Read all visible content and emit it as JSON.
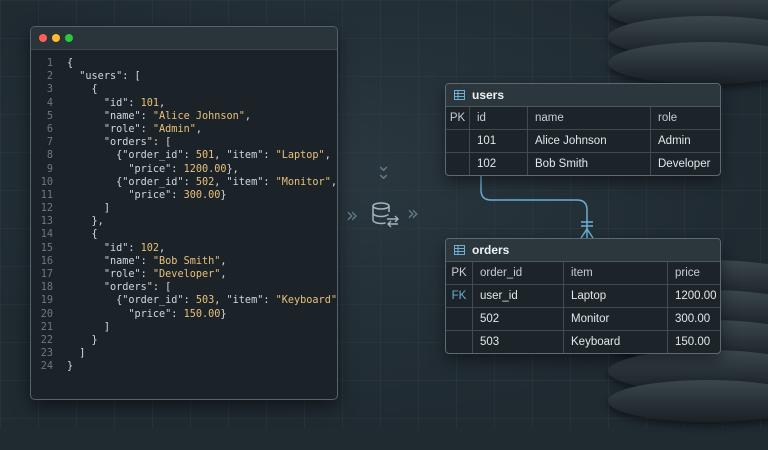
{
  "window": {
    "controls": [
      {
        "name": "close",
        "color": "#ff5f57"
      },
      {
        "name": "minimize",
        "color": "#febc2e"
      },
      {
        "name": "maximize",
        "color": "#28c840"
      }
    ]
  },
  "code": {
    "lines": [
      {
        "n": "1",
        "indent": 0,
        "tokens": [
          [
            "p",
            "{"
          ]
        ]
      },
      {
        "n": "2",
        "indent": 1,
        "tokens": [
          [
            "k",
            "\"users\""
          ],
          [
            "p",
            ": ["
          ]
        ]
      },
      {
        "n": "3",
        "indent": 2,
        "tokens": [
          [
            "p",
            "{"
          ]
        ]
      },
      {
        "n": "4",
        "indent": 3,
        "tokens": [
          [
            "k",
            "\"id\""
          ],
          [
            "p",
            ": "
          ],
          [
            "n",
            "101"
          ],
          [
            "p",
            ","
          ]
        ]
      },
      {
        "n": "5",
        "indent": 3,
        "tokens": [
          [
            "k",
            "\"name\""
          ],
          [
            "p",
            ": "
          ],
          [
            "s",
            "\"Alice Johnson\""
          ],
          [
            "p",
            ","
          ]
        ]
      },
      {
        "n": "6",
        "indent": 3,
        "tokens": [
          [
            "k",
            "\"role\""
          ],
          [
            "p",
            ": "
          ],
          [
            "s",
            "\"Admin\""
          ],
          [
            "p",
            ","
          ]
        ]
      },
      {
        "n": "7",
        "indent": 3,
        "tokens": [
          [
            "k",
            "\"orders\""
          ],
          [
            "p",
            ": ["
          ]
        ]
      },
      {
        "n": "8",
        "indent": 4,
        "tokens": [
          [
            "p",
            "{"
          ],
          [
            "k",
            "\"order_id\""
          ],
          [
            "p",
            ": "
          ],
          [
            "n",
            "501"
          ],
          [
            "p",
            ", "
          ],
          [
            "k",
            "\"item\""
          ],
          [
            "p",
            ": "
          ],
          [
            "s",
            "\"Laptop\""
          ],
          [
            "p",
            ","
          ]
        ]
      },
      {
        "n": "9",
        "indent": 5,
        "tokens": [
          [
            "k",
            "\"price\""
          ],
          [
            "p",
            ": "
          ],
          [
            "n",
            "1200.00"
          ],
          [
            "p",
            "},"
          ]
        ]
      },
      {
        "n": "10",
        "indent": 4,
        "tokens": [
          [
            "p",
            "{"
          ],
          [
            "k",
            "\"order_id\""
          ],
          [
            "p",
            ": "
          ],
          [
            "n",
            "502"
          ],
          [
            "p",
            ", "
          ],
          [
            "k",
            "\"item\""
          ],
          [
            "p",
            ": "
          ],
          [
            "s",
            "\"Monitor\""
          ],
          [
            "p",
            ","
          ]
        ]
      },
      {
        "n": "11",
        "indent": 5,
        "tokens": [
          [
            "k",
            "\"price\""
          ],
          [
            "p",
            ": "
          ],
          [
            "n",
            "300.00"
          ],
          [
            "p",
            "}"
          ]
        ]
      },
      {
        "n": "12",
        "indent": 3,
        "tokens": [
          [
            "p",
            "]"
          ]
        ]
      },
      {
        "n": "13",
        "indent": 2,
        "tokens": [
          [
            "p",
            "},"
          ]
        ]
      },
      {
        "n": "14",
        "indent": 2,
        "tokens": [
          [
            "p",
            "{"
          ]
        ]
      },
      {
        "n": "15",
        "indent": 3,
        "tokens": [
          [
            "k",
            "\"id\""
          ],
          [
            "p",
            ": "
          ],
          [
            "n",
            "102"
          ],
          [
            "p",
            ","
          ]
        ]
      },
      {
        "n": "16",
        "indent": 3,
        "tokens": [
          [
            "k",
            "\"name\""
          ],
          [
            "p",
            ": "
          ],
          [
            "s",
            "\"Bob Smith\""
          ],
          [
            "p",
            ","
          ]
        ]
      },
      {
        "n": "17",
        "indent": 3,
        "tokens": [
          [
            "k",
            "\"role\""
          ],
          [
            "p",
            ": "
          ],
          [
            "s",
            "\"Developer\""
          ],
          [
            "p",
            ","
          ]
        ]
      },
      {
        "n": "18",
        "indent": 3,
        "tokens": [
          [
            "k",
            "\"orders\""
          ],
          [
            "p",
            ": ["
          ]
        ]
      },
      {
        "n": "19",
        "indent": 4,
        "tokens": [
          [
            "p",
            "{"
          ],
          [
            "k",
            "\"order_id\""
          ],
          [
            "p",
            ": "
          ],
          [
            "n",
            "503"
          ],
          [
            "p",
            ", "
          ],
          [
            "k",
            "\"item\""
          ],
          [
            "p",
            ": "
          ],
          [
            "s",
            "\"Keyboard\""
          ],
          [
            "p",
            ","
          ]
        ]
      },
      {
        "n": "20",
        "indent": 5,
        "tokens": [
          [
            "k",
            "\"price\""
          ],
          [
            "p",
            ": "
          ],
          [
            "n",
            "150.00"
          ],
          [
            "p",
            "}"
          ]
        ]
      },
      {
        "n": "21",
        "indent": 3,
        "tokens": [
          [
            "p",
            "]"
          ]
        ]
      },
      {
        "n": "22",
        "indent": 2,
        "tokens": [
          [
            "p",
            "}"
          ]
        ]
      },
      {
        "n": "23",
        "indent": 1,
        "tokens": [
          [
            "p",
            "]"
          ]
        ]
      },
      {
        "n": "24",
        "indent": 0,
        "tokens": [
          [
            "p",
            "}"
          ]
        ]
      }
    ]
  },
  "flow": {
    "arrow_left": "»",
    "arrow_right": "›",
    "arrow_down": "⌄",
    "icon": "database-transform-icon"
  },
  "users_table": {
    "title": "users",
    "columns": [
      "PK",
      "id",
      "name",
      "role"
    ],
    "rows": [
      [
        "",
        "101",
        "Alice Johnson",
        "Admin"
      ],
      [
        "",
        "102",
        "Bob Smith",
        "Developer"
      ]
    ]
  },
  "orders_table": {
    "title": "orders",
    "columns": [
      "PK",
      "order_id",
      "item",
      "price"
    ],
    "rows": [
      [
        "FK",
        "user_id",
        "Laptop",
        "1200.00"
      ],
      [
        "",
        "502",
        "Monitor",
        "300.00"
      ],
      [
        "",
        "503",
        "Keyboard",
        "150.00"
      ]
    ]
  },
  "colors": {
    "background": "#1f2a31",
    "string": "#e8c07a",
    "fk": "#6cb0d6",
    "connector": "#6cb0d6"
  }
}
